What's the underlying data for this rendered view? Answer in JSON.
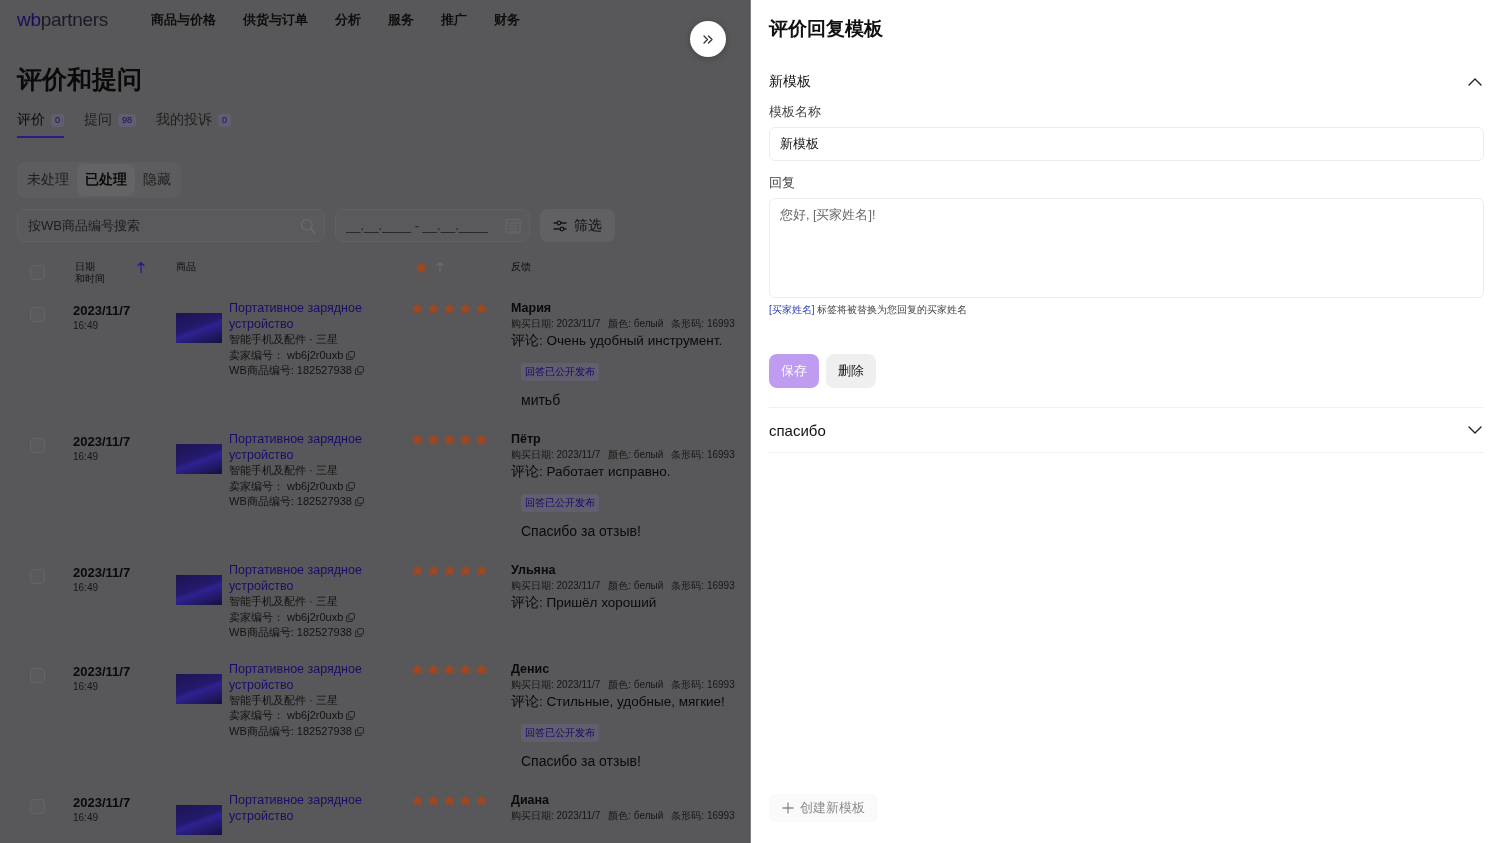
{
  "logo": {
    "mark": "wb",
    "text": "partners"
  },
  "nav": [
    "商品与价格",
    "供货与订单",
    "分析",
    "服务",
    "推广",
    "财务"
  ],
  "page_title": "评价和提问",
  "tabs": [
    {
      "label": "评价",
      "count": "0",
      "selected": true
    },
    {
      "label": "提问",
      "count": "98",
      "selected": false
    },
    {
      "label": "我的投诉",
      "count": "0",
      "selected": false
    }
  ],
  "status_filters": [
    {
      "label": "未处理",
      "selected": false
    },
    {
      "label": "已处理",
      "selected": true
    },
    {
      "label": "隐藏",
      "selected": false
    }
  ],
  "search": {
    "placeholder": "按WB商品编号搜索"
  },
  "date_range": {
    "placeholder": "__.__.____ - __.__.____"
  },
  "filter_button": {
    "label": "筛选"
  },
  "table": {
    "select_all": {
      "checked": false
    },
    "columns": [
      {
        "kind": "stacked",
        "lines": [
          "日期",
          "和时间"
        ],
        "sort_active": true
      },
      {
        "kind": "text",
        "label": "商品"
      },
      {
        "kind": "rating",
        "sort_active": false
      },
      {
        "kind": "text",
        "label": "反馈"
      }
    ],
    "rows": [
      {
        "checked": false,
        "date": "2023/11/7",
        "time": "16:49",
        "product": {
          "title": "Портативное зарядное устройство",
          "category": "智能手机及配件 · 三星",
          "seller": "卖家编号： wb6j2r0uxb",
          "wb_id": "WB商品编号: 182527938"
        },
        "stars": 5,
        "buyer": "Мария",
        "meta": [
          "购买日期: 2023/11/7",
          "颜色: белый",
          "条形码: 16993"
        ],
        "comment": "评论: Очень удобный инструмент.",
        "reply": {
          "status": "回答已公开发布",
          "text": "митьб"
        }
      },
      {
        "checked": false,
        "date": "2023/11/7",
        "time": "16:49",
        "product": {
          "title": "Портативное зарядное устройство",
          "category": "智能手机及配件 · 三星",
          "seller": "卖家编号： wb6j2r0uxb",
          "wb_id": "WB商品编号: 182527938"
        },
        "stars": 5,
        "buyer": "Пётр",
        "meta": [
          "购买日期: 2023/11/7",
          "颜色: белый",
          "条形码: 16993"
        ],
        "comment": "评论: Работает исправно.",
        "reply": {
          "status": "回答已公开发布",
          "text": "Спасибо за отзыв!"
        }
      },
      {
        "checked": false,
        "date": "2023/11/7",
        "time": "16:49",
        "product": {
          "title": "Портативное зарядное устройство",
          "category": "智能手机及配件 · 三星",
          "seller": "卖家编号： wb6j2r0uxb",
          "wb_id": "WB商品编号: 182527938"
        },
        "stars": 5,
        "buyer": "Ульяна",
        "meta": [
          "购买日期: 2023/11/7",
          "颜色: белый",
          "条形码: 16993"
        ],
        "comment": "评论: Пришёл хороший"
      },
      {
        "checked": false,
        "date": "2023/11/7",
        "time": "16:49",
        "product": {
          "title": "Портативное зарядное устройство",
          "category": "智能手机及配件 · 三星",
          "seller": "卖家编号： wb6j2r0uxb",
          "wb_id": "WB商品编号: 182527938"
        },
        "stars": 5,
        "buyer": "Денис",
        "meta": [
          "购买日期: 2023/11/7",
          "颜色: белый",
          "条形码: 16993"
        ],
        "comment": "评论: Стильные, удобные, мягкие!",
        "reply": {
          "status": "回答已公开发布",
          "text": "Спасибо за отзыв!"
        }
      },
      {
        "checked": false,
        "date": "2023/11/7",
        "time": "16:49",
        "product": {
          "title": "Портативное зарядное устройство"
        },
        "stars": 5,
        "buyer": "Диана",
        "meta": [
          "购买日期: 2023/11/7",
          "颜色: белый",
          "条形码: 16993"
        ]
      }
    ]
  },
  "panel": {
    "title": "评价回复模板",
    "templates": [
      {
        "name": "新模板",
        "expanded": true,
        "form": {
          "name_label": "模板名称",
          "name_value": "新模板",
          "reply_label": "回复",
          "reply_placeholder": "您好, [买家姓名]!",
          "hint": {
            "tag": "[买家姓名]",
            "text": "标签将被替换为您回复的买家姓名"
          }
        },
        "buttons": [
          {
            "label": "保存",
            "kind": "primary",
            "disabled": true
          },
          {
            "label": "删除",
            "kind": "secondary",
            "disabled": false
          }
        ]
      },
      {
        "name": "спасибо",
        "expanded": false
      }
    ],
    "create_button": {
      "label": "创建新模板",
      "disabled": true
    }
  }
}
